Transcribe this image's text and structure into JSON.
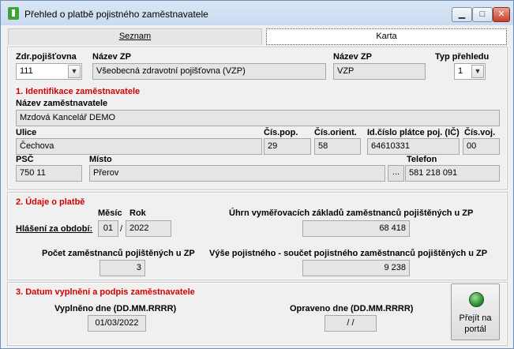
{
  "window": {
    "title": "Přehled o platbě pojistného zaměstnavatele",
    "min": "▁",
    "max": "□",
    "close": "✕"
  },
  "tabs": {
    "seznam": "Seznam",
    "karta": "Karta"
  },
  "top": {
    "zdr_label": "Zdr.pojišťovna",
    "zdr_value": "111",
    "nazev_zp_label": "Název ZP",
    "nazev_zp_value": "Všeobecná zdravotní pojišťovna (VZP)",
    "nazev_zp2_label": "Název ZP",
    "nazev_zp2_value": "VZP",
    "typ_label": "Typ přehledu",
    "typ_value": "1"
  },
  "section1": {
    "header": "1. Identifikace zaměstnavatele",
    "nazev_label": "Název zaměstnavatele",
    "nazev_value": "Mzdová Kancelář DEMO",
    "ulice_label": "Ulice",
    "ulice_value": "Čechova",
    "cispop_label": "Čís.pop.",
    "cispop_value": "29",
    "cisorient_label": "Čís.orient.",
    "cisorient_value": "58",
    "ic_label": "Id.číslo plátce poj. (IČ)",
    "ic_value": "64610331",
    "cisvoj_label": "Čís.voj.",
    "cisvoj_value": "00",
    "psc_label": "PSČ",
    "psc_value": "750 11",
    "misto_label": "Místo",
    "misto_value": "Přerov",
    "ellipsis": "...",
    "telefon_label": "Telefon",
    "telefon_value": "581 218 091"
  },
  "section2": {
    "header": "2. Údaje o platbě",
    "hlaseni_label": "Hlášení za období:",
    "mesic_label": "Měsíc",
    "mesic_value": "01",
    "slash": "/",
    "rok_label": "Rok",
    "rok_value": "2022",
    "uhrn_label": "Úhrn vyměřovacích základů zaměstnanců pojištěných u ZP",
    "uhrn_value": "68 418",
    "pocet_label": "Počet zaměstnanců pojištěných u ZP",
    "pocet_value": "3",
    "vyse_label": "Výše pojistného - součet pojistného zaměstnanců pojištěných u ZP",
    "vyse_value": "9 238"
  },
  "section3": {
    "header": "3. Datum vyplnění a podpis zaměstnavatele",
    "vyplneno_label": "Vyplněno dne (DD.MM.RRRR)",
    "vyplneno_value": "01/03/2022",
    "opraveno_label": "Opraveno dne (DD.MM.RRRR)",
    "opraveno_value": " / /",
    "portal_label": "Přejít na\nportál"
  }
}
